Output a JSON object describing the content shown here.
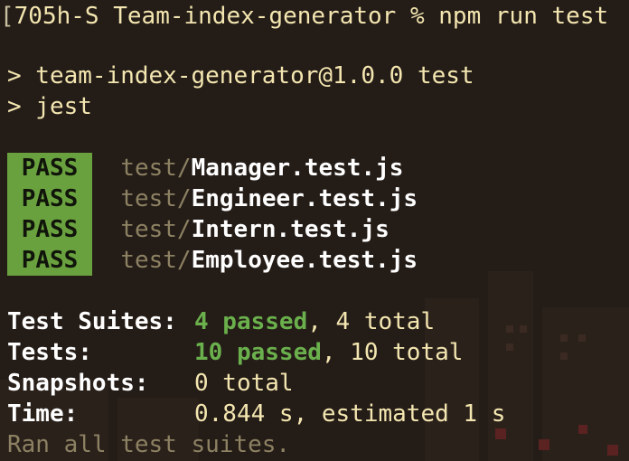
{
  "terminal": {
    "command_line": {
      "prefix": "[",
      "host": "705h-S",
      "cwd": "Team-index-generator",
      "prompt_symbol": "%",
      "command": "npm run test"
    },
    "script_header": {
      "line1": "> team-index-generator@1.0.0 test",
      "line2": "> jest"
    },
    "results": [
      {
        "status": "PASS",
        "dir": "test/",
        "file": "Manager.test.js"
      },
      {
        "status": "PASS",
        "dir": "test/",
        "file": "Engineer.test.js"
      },
      {
        "status": "PASS",
        "dir": "test/",
        "file": "Intern.test.js"
      },
      {
        "status": "PASS",
        "dir": "test/",
        "file": "Employee.test.js"
      }
    ],
    "summary": {
      "suites_label": "Test Suites:",
      "suites_passed": "4 passed",
      "suites_total": ", 4 total",
      "tests_label": "Tests:",
      "tests_passed": "10 passed",
      "tests_total": ", 10 total",
      "snapshots_label": "Snapshots:",
      "snapshots_value": "0 total",
      "time_label": "Time:",
      "time_value": "0.844 s, estimated 1 s",
      "footer": "Ran all test suites."
    }
  },
  "colors": {
    "background": "#241c17",
    "text": "#f3e6b0",
    "pass_badge": "#6aa13f",
    "passed_text": "#6ab04c",
    "dim_text": "#8c8162"
  }
}
